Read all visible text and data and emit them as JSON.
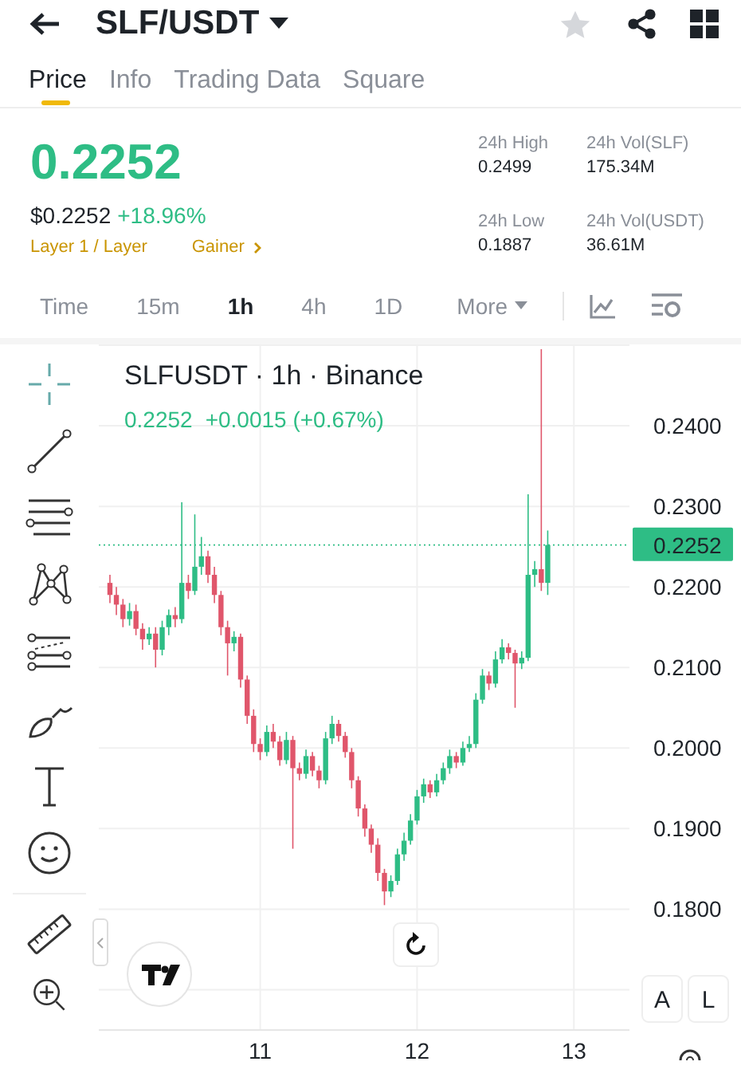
{
  "header": {
    "title": "SLF/USDT",
    "favorite": false
  },
  "tabs": [
    {
      "label": "Price",
      "selected": true
    },
    {
      "label": "Info",
      "selected": false
    },
    {
      "label": "Trading Data",
      "selected": false
    },
    {
      "label": "Square",
      "selected": false
    }
  ],
  "price": {
    "last": "0.2252",
    "usd": "$0.2252",
    "change": "+18.96%",
    "tags": [
      "Layer 1 / Layer",
      "Gainer"
    ]
  },
  "stats": [
    {
      "label": "24h High",
      "value": "0.2499"
    },
    {
      "label": "24h Vol(SLF)",
      "value": "175.34M"
    },
    {
      "label": "24h Low",
      "value": "0.1887"
    },
    {
      "label": "24h Vol(USDT)",
      "value": "36.61M"
    }
  ],
  "intervals": [
    {
      "label": "Time",
      "selected": false
    },
    {
      "label": "15m",
      "selected": false
    },
    {
      "label": "1h",
      "selected": true
    },
    {
      "label": "4h",
      "selected": false
    },
    {
      "label": "1D",
      "selected": false
    },
    {
      "label": "More",
      "selected": false
    }
  ],
  "chart": {
    "quote": "0.2252",
    "change": "+0.0015 (+0.67%)",
    "price_label": "0.2252",
    "scale_buttons": [
      "A",
      "L"
    ],
    "chart_data": {
      "type": "candlestick",
      "title": "SLFUSDT · 1h · Binance",
      "x": [
        10.042,
        10.083,
        10.125,
        10.167,
        10.208,
        10.25,
        10.292,
        10.333,
        10.375,
        10.417,
        10.458,
        10.5,
        10.542,
        10.583,
        10.625,
        10.667,
        10.708,
        10.75,
        10.792,
        10.833,
        10.875,
        10.917,
        10.958,
        11,
        11.042,
        11.083,
        11.125,
        11.167,
        11.208,
        11.25,
        11.292,
        11.333,
        11.375,
        11.417,
        11.458,
        11.5,
        11.542,
        11.583,
        11.625,
        11.667,
        11.708,
        11.75,
        11.792,
        11.833,
        11.875,
        11.917,
        11.958,
        12,
        12.042,
        12.083,
        12.125,
        12.167,
        12.208,
        12.25,
        12.292,
        12.333,
        12.375,
        12.417,
        12.458,
        12.5,
        12.542,
        12.583,
        12.625,
        12.667,
        12.708,
        12.75,
        12.792,
        12.833
      ],
      "ohlc": [
        [
          0.2205,
          0.2215,
          0.218,
          0.219
        ],
        [
          0.219,
          0.22,
          0.2165,
          0.2178
        ],
        [
          0.2178,
          0.2185,
          0.215,
          0.216
        ],
        [
          0.216,
          0.218,
          0.2152,
          0.217
        ],
        [
          0.217,
          0.2178,
          0.214,
          0.2148
        ],
        [
          0.2148,
          0.2155,
          0.2122,
          0.2135
        ],
        [
          0.2135,
          0.215,
          0.2128,
          0.2142
        ],
        [
          0.2142,
          0.215,
          0.21,
          0.2122
        ],
        [
          0.2122,
          0.2158,
          0.2115,
          0.215
        ],
        [
          0.215,
          0.2172,
          0.214,
          0.2165
        ],
        [
          0.2165,
          0.2175,
          0.215,
          0.216
        ],
        [
          0.216,
          0.2305,
          0.2155,
          0.2205
        ],
        [
          0.2205,
          0.2215,
          0.2185,
          0.2195
        ],
        [
          0.2195,
          0.229,
          0.219,
          0.2225
        ],
        [
          0.2225,
          0.2262,
          0.2215,
          0.2238
        ],
        [
          0.2238,
          0.2245,
          0.2205,
          0.2215
        ],
        [
          0.2215,
          0.2225,
          0.218,
          0.219
        ],
        [
          0.219,
          0.2195,
          0.214,
          0.215
        ],
        [
          0.215,
          0.2158,
          0.209,
          0.213
        ],
        [
          0.213,
          0.2145,
          0.212,
          0.2138
        ],
        [
          0.2138,
          0.2142,
          0.2075,
          0.2085
        ],
        [
          0.2085,
          0.209,
          0.203,
          0.204
        ],
        [
          0.204,
          0.2048,
          0.1995,
          0.2005
        ],
        [
          0.2005,
          0.2012,
          0.1985,
          0.1995
        ],
        [
          0.1995,
          0.2028,
          0.199,
          0.202
        ],
        [
          0.202,
          0.203,
          0.2,
          0.2008
        ],
        [
          0.2008,
          0.2015,
          0.1978,
          0.1985
        ],
        [
          0.1985,
          0.202,
          0.198,
          0.201
        ],
        [
          0.201,
          0.2015,
          0.1875,
          0.1975
        ],
        [
          0.1975,
          0.1982,
          0.196,
          0.1968
        ],
        [
          0.1968,
          0.1998,
          0.1962,
          0.199
        ],
        [
          0.199,
          0.1995,
          0.1965,
          0.1972
        ],
        [
          0.1972,
          0.1978,
          0.195,
          0.196
        ],
        [
          0.196,
          0.202,
          0.1955,
          0.2012
        ],
        [
          0.2012,
          0.204,
          0.2005,
          0.203
        ],
        [
          0.203,
          0.2035,
          0.2008,
          0.2015
        ],
        [
          0.2015,
          0.202,
          0.1988,
          0.1995
        ],
        [
          0.1995,
          0.2,
          0.195,
          0.196
        ],
        [
          0.196,
          0.1965,
          0.1915,
          0.1925
        ],
        [
          0.1925,
          0.193,
          0.189,
          0.19
        ],
        [
          0.19,
          0.1905,
          0.187,
          0.188
        ],
        [
          0.188,
          0.1888,
          0.1835,
          0.1845
        ],
        [
          0.1845,
          0.185,
          0.1805,
          0.1822
        ],
        [
          0.1822,
          0.1842,
          0.1815,
          0.1835
        ],
        [
          0.1835,
          0.1875,
          0.183,
          0.1868
        ],
        [
          0.1868,
          0.1895,
          0.186,
          0.1885
        ],
        [
          0.1885,
          0.1918,
          0.188,
          0.191
        ],
        [
          0.191,
          0.1948,
          0.1905,
          0.194
        ],
        [
          0.194,
          0.1962,
          0.1932,
          0.1955
        ],
        [
          0.1955,
          0.196,
          0.1938,
          0.1945
        ],
        [
          0.1945,
          0.1968,
          0.194,
          0.196
        ],
        [
          0.196,
          0.1982,
          0.1955,
          0.1975
        ],
        [
          0.1975,
          0.1998,
          0.1968,
          0.199
        ],
        [
          0.199,
          0.1995,
          0.1975,
          0.1982
        ],
        [
          0.1982,
          0.2008,
          0.1978,
          0.2
        ],
        [
          0.2,
          0.2015,
          0.1995,
          0.2005
        ],
        [
          0.2005,
          0.2068,
          0.2,
          0.206
        ],
        [
          0.206,
          0.2098,
          0.2055,
          0.209
        ],
        [
          0.209,
          0.2095,
          0.2072,
          0.208
        ],
        [
          0.208,
          0.212,
          0.2075,
          0.211
        ],
        [
          0.211,
          0.2135,
          0.2105,
          0.2125
        ],
        [
          0.2125,
          0.213,
          0.211,
          0.2118
        ],
        [
          0.2118,
          0.2122,
          0.205,
          0.2105
        ],
        [
          0.2105,
          0.212,
          0.2098,
          0.2112
        ],
        [
          0.2112,
          0.2315,
          0.2108,
          0.2215
        ],
        [
          0.2215,
          0.2232,
          0.22,
          0.2222
        ],
        [
          0.2222,
          0.2495,
          0.2195,
          0.2205
        ],
        [
          0.2205,
          0.227,
          0.219,
          0.2252
        ]
      ],
      "grid": true,
      "ref_lines": [
        {
          "axis": "y",
          "value": 0.2252
        }
      ],
      "xlim": [
        9.971,
        13.354
      ],
      "ylim": [
        0.165,
        0.2501
      ],
      "yticks": [
        {
          "value": 0.24,
          "label": "0.2400"
        },
        {
          "value": 0.23,
          "label": "0.2300"
        },
        {
          "value": 0.22,
          "label": "0.2200"
        },
        {
          "value": 0.21,
          "label": "0.2100"
        },
        {
          "value": 0.2,
          "label": "0.2000"
        },
        {
          "value": 0.19,
          "label": "0.1900"
        },
        {
          "value": 0.18,
          "label": "0.1800"
        }
      ],
      "xticks": [
        {
          "value": 11,
          "label": "11"
        },
        {
          "value": 12,
          "label": "12"
        },
        {
          "value": 13,
          "label": "13"
        }
      ]
    }
  }
}
